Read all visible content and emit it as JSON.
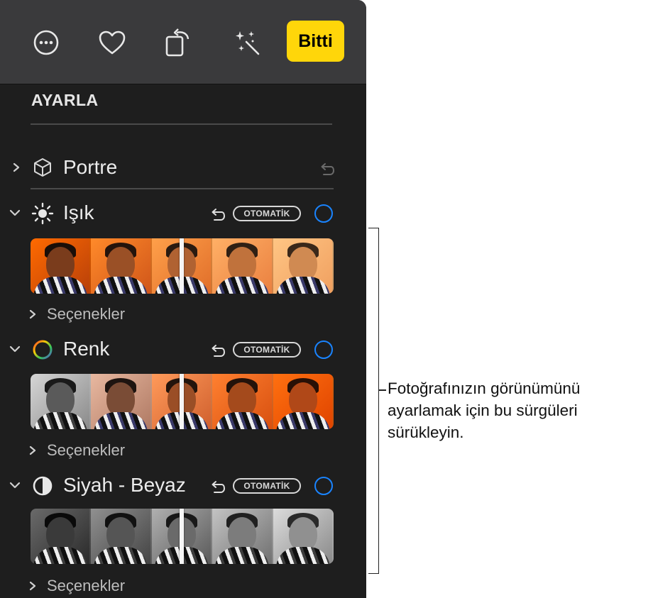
{
  "toolbar": {
    "icons": [
      "more-icon",
      "heart-icon",
      "rotate-icon",
      "magic-wand-icon"
    ],
    "done_label": "Bitti",
    "accent": "#ffd60a"
  },
  "panel": {
    "heading": "AYARLA",
    "portre": {
      "label": "Portre"
    },
    "sections": [
      {
        "label": "Işık",
        "auto_label": "OTOMATİK",
        "options_label": "Seçenekler",
        "icon": "sun-icon"
      },
      {
        "label": "Renk",
        "auto_label": "OTOMATİK",
        "options_label": "Seçenekler",
        "icon": "color-circle-icon"
      },
      {
        "label": "Siyah - Beyaz",
        "auto_label": "OTOMATİK",
        "options_label": "Seçenekler",
        "icon": "half-circle-icon"
      }
    ],
    "ring_color": "#1a84ff"
  },
  "callout": {
    "lines": [
      "Fotoğrafınızın görünümünü",
      "ayarlamak için bu sürgüleri",
      "sürükleyin."
    ]
  }
}
